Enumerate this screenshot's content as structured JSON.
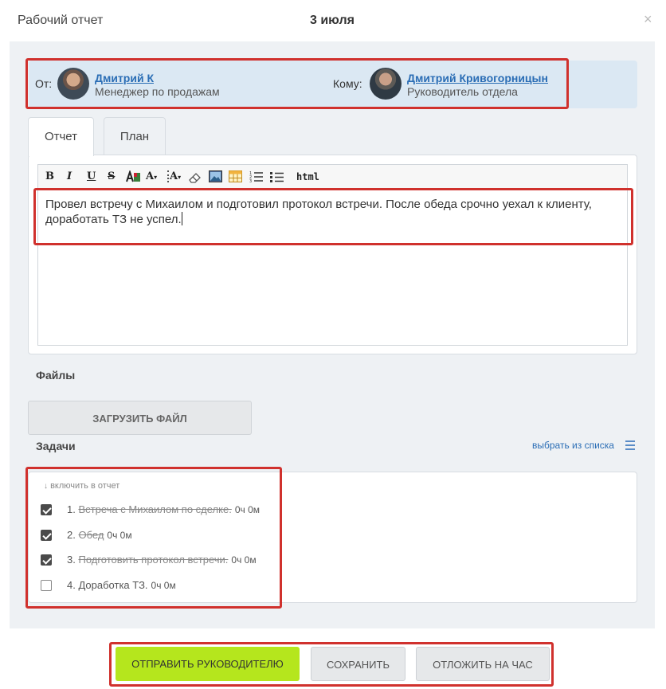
{
  "header": {
    "title": "Рабочий отчет",
    "date": "3 июля",
    "close_glyph": "×"
  },
  "people": {
    "from_label": "От:",
    "from": {
      "name": "Дмитрий К",
      "role": "Менеджер по продажам"
    },
    "to_label": "Кому:",
    "to": {
      "name": "Дмитрий Кривогорницын",
      "role": "Руководитель отдела"
    }
  },
  "tabs": [
    {
      "label": "Отчет",
      "active": true
    },
    {
      "label": "План",
      "active": false
    }
  ],
  "toolbar": {
    "bold": "B",
    "italic": "I",
    "underline": "U",
    "strike": "S",
    "text_color": "A",
    "font_size": "A",
    "html": "html"
  },
  "editor": {
    "content": "Провел встречу с Михаилом и подготовил протокол встречи. После обеда срочно уехал к клиенту, доработать ТЗ не успел."
  },
  "files": {
    "label": "Файлы",
    "upload_button": "ЗАГРУЗИТЬ ФАЙЛ"
  },
  "tasks": {
    "label": "Задачи",
    "pick_link": "выбрать из списка",
    "hint": "включить в отчет",
    "items": [
      {
        "num": "1.",
        "title": "Встреча с Михаилом по сделке.",
        "time": "0ч 0м",
        "checked": true,
        "done": true
      },
      {
        "num": "2.",
        "title": "Обед",
        "time": "0ч 0м",
        "checked": true,
        "done": true
      },
      {
        "num": "3.",
        "title": "Подготовить протокол встречи.",
        "time": "0ч 0м",
        "checked": true,
        "done": true
      },
      {
        "num": "4.",
        "title": "Доработка ТЗ.",
        "time": "0ч 0м",
        "checked": false,
        "done": false
      }
    ]
  },
  "actions": {
    "send": "ОТПРАВИТЬ РУКОВОДИТЕЛЮ",
    "save": "СОХРАНИТЬ",
    "postpone": "ОТЛОЖИТЬ НА ЧАС"
  },
  "colors": {
    "accent_link": "#2a6db5",
    "primary_button": "#b5e61d",
    "highlight_border": "#d0312d",
    "people_bg": "#dbe8f3"
  }
}
